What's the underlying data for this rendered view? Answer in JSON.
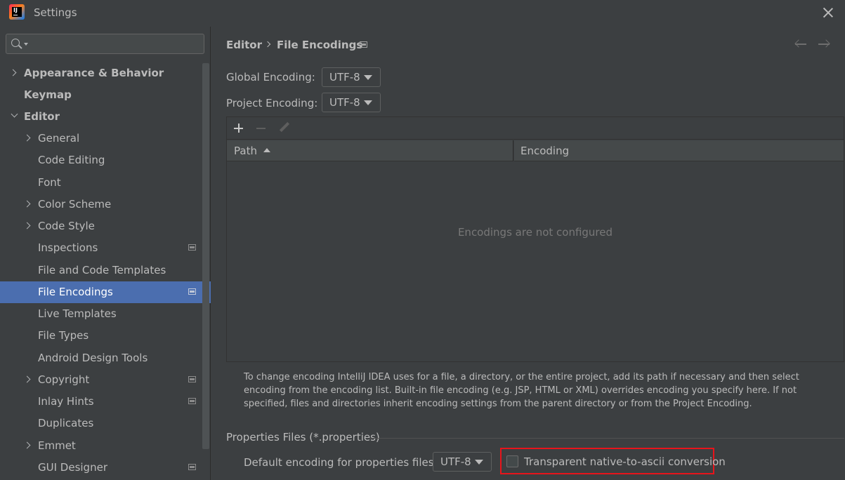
{
  "window": {
    "title": "Settings"
  },
  "sidebar": {
    "search": {
      "value": "",
      "placeholder": ""
    },
    "items": [
      {
        "label": "Appearance & Behavior"
      },
      {
        "label": "Keymap"
      },
      {
        "label": "Editor"
      },
      {
        "label": "General"
      },
      {
        "label": "Code Editing"
      },
      {
        "label": "Font"
      },
      {
        "label": "Color Scheme"
      },
      {
        "label": "Code Style"
      },
      {
        "label": "Inspections"
      },
      {
        "label": "File and Code Templates"
      },
      {
        "label": "File Encodings"
      },
      {
        "label": "Live Templates"
      },
      {
        "label": "File Types"
      },
      {
        "label": "Android Design Tools"
      },
      {
        "label": "Copyright"
      },
      {
        "label": "Inlay Hints"
      },
      {
        "label": "Duplicates"
      },
      {
        "label": "Emmet"
      },
      {
        "label": "GUI Designer"
      }
    ]
  },
  "main": {
    "breadcrumb": {
      "root": "Editor",
      "leaf": "File Encodings"
    },
    "global_encoding": {
      "label": "Global Encoding:",
      "value": "UTF-8"
    },
    "project_encoding": {
      "label": "Project Encoding:",
      "value": "UTF-8"
    },
    "table": {
      "columns": [
        "Path",
        "Encoding"
      ],
      "empty_text": "Encodings are not configured"
    },
    "help_text": "To change encoding IntelliJ IDEA uses for a file, a directory, or the entire project, add its path if necessary and then select encoding from the encoding list. Built-in file encoding (e.g. JSP, HTML or XML) overrides encoding you specify here. If not specified, files and directories inherit encoding settings from the parent directory or from the Project Encoding.",
    "properties_section": {
      "title": "Properties Files (*.properties)",
      "default_encoding_label": "Default encoding for properties files:",
      "default_encoding_value": "UTF-8",
      "transparent_conversion_label": "Transparent native-to-ascii conversion",
      "transparent_conversion_checked": false
    }
  },
  "colors": {
    "background": "#3c3f41",
    "selection": "#4b6eaf",
    "highlight_box": "#e8141b"
  }
}
